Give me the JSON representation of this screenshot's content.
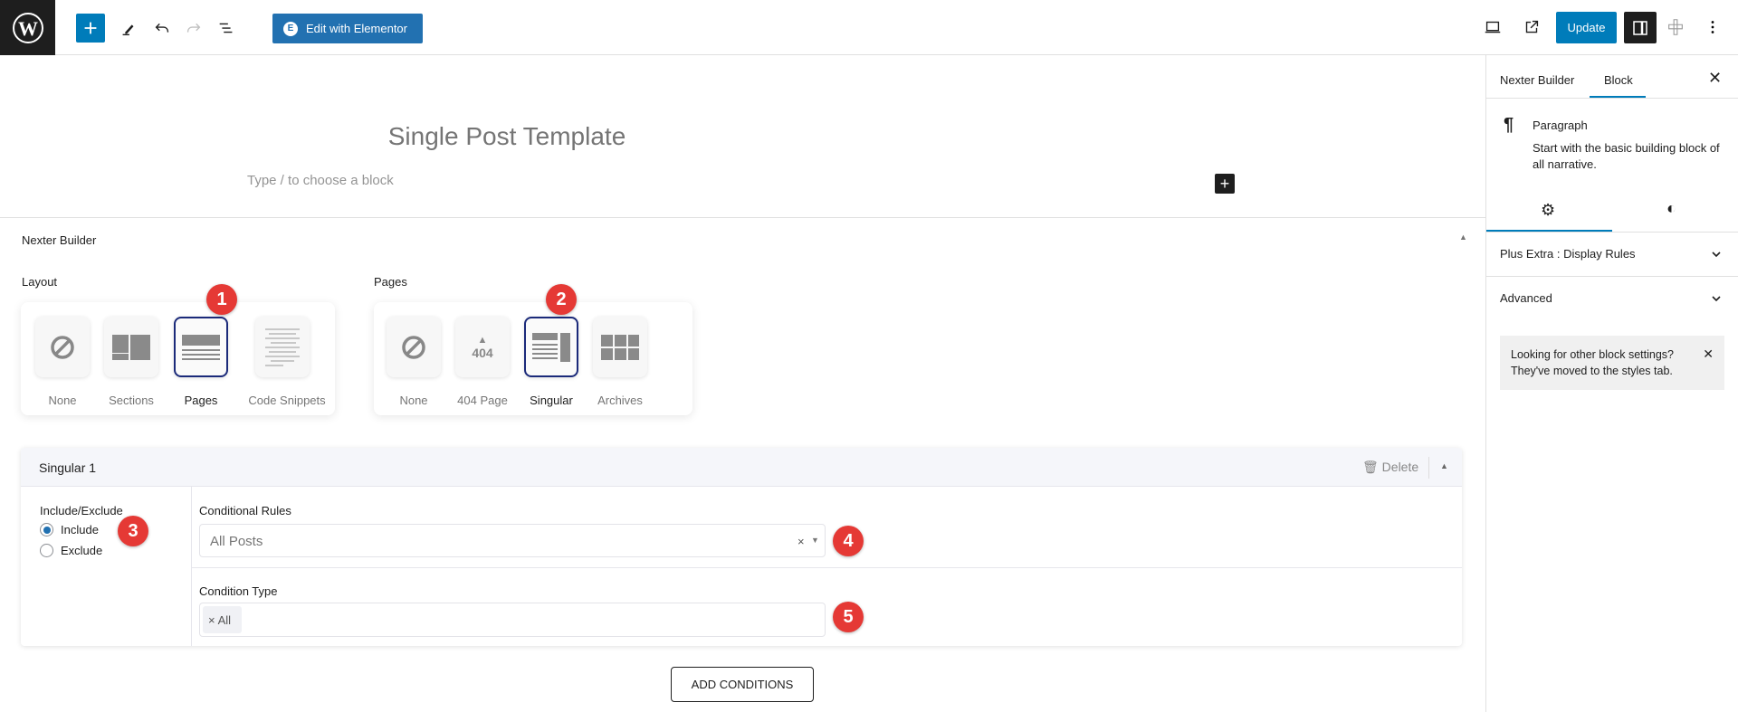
{
  "topbar": {
    "elementor_label": "Edit with Elementor",
    "update_label": "Update",
    "icons": [
      "wordpress-logo",
      "plus-icon",
      "pen-icon",
      "undo-icon",
      "redo-icon",
      "list-view-icon",
      "laptop-icon",
      "external-link-icon",
      "sidebar-icon",
      "plugin-icon",
      "kebab-icon"
    ],
    "accent": "#007cba"
  },
  "canvas": {
    "title": "Single Post Template",
    "placeholder": "Type / to choose a block"
  },
  "nexter": {
    "panel_title": "Nexter Builder",
    "layout": {
      "label": "Layout",
      "items": [
        {
          "label": "None"
        },
        {
          "label": "Sections"
        },
        {
          "label": "Pages",
          "selected": true
        },
        {
          "label": "Code Snippets"
        }
      ]
    },
    "pages": {
      "label": "Pages",
      "items": [
        {
          "label": "None"
        },
        {
          "label": "404 Page"
        },
        {
          "label": "Singular",
          "selected": true
        },
        {
          "label": "Archives"
        }
      ]
    },
    "singular": {
      "title": "Singular 1",
      "delete_label": "Delete",
      "include_exclude_label": "Include/Exclude",
      "include": "Include",
      "exclude": "Exclude",
      "selected": "Include",
      "rules_label": "Conditional Rules",
      "rules_value": "All Posts",
      "type_label": "Condition Type",
      "type_tag": "All"
    },
    "add_conditions": "ADD CONDITIONS"
  },
  "badges": [
    "1",
    "2",
    "3",
    "4",
    "5"
  ],
  "sidebar": {
    "tabs": [
      "Nexter Builder",
      "Block"
    ],
    "active_tab": "Block",
    "block_name": "Paragraph",
    "block_desc": "Start with the basic building block of all narrative.",
    "panels": [
      "Plus Extra : Display Rules",
      "Advanced"
    ],
    "notice": "Looking for other block settings? They've moved to the styles tab."
  }
}
